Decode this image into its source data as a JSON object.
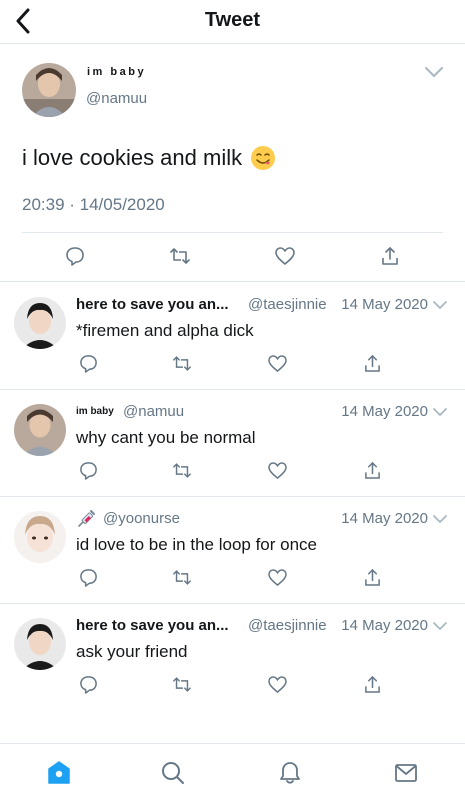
{
  "header": {
    "title": "Tweet"
  },
  "main_tweet": {
    "name": "im baby",
    "handle": "@namuu",
    "text": "i love cookies and milk",
    "emoji": "yum-face-icon",
    "timestamp": "20:39 · 14/05/2020"
  },
  "replies": [
    {
      "name": "here to save you an...",
      "handle": "@taesjinnie",
      "date": "14 May 2020",
      "text": "*firemen and alpha dick"
    },
    {
      "name": "im baby",
      "handle": "@namuu",
      "date": "14 May 2020",
      "text": "why cant you be normal"
    },
    {
      "name_emoji": "syringe-icon",
      "handle": "@yoonurse",
      "date": "14 May 2020",
      "text": "id love to be in the loop for once"
    },
    {
      "name": "here to save you an...",
      "handle": "@taesjinnie",
      "date": "14 May 2020",
      "text": "ask your friend"
    }
  ],
  "tabs": [
    "home-icon",
    "search-icon",
    "bell-icon",
    "mail-icon"
  ],
  "colors": {
    "accent": "#1da1f2",
    "secondary_text": "#657786",
    "icon": "#657786",
    "divider": "#e1e8ed"
  }
}
